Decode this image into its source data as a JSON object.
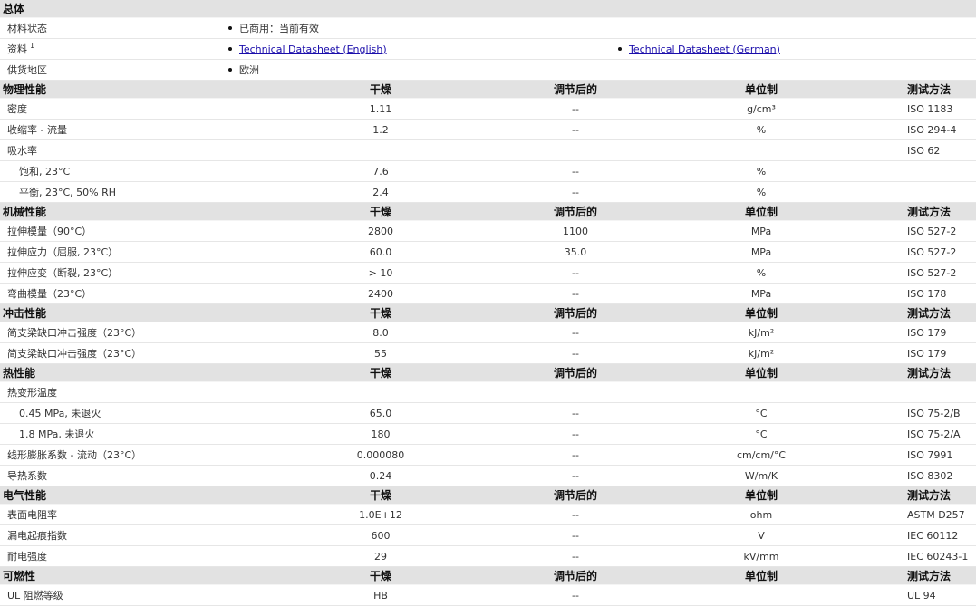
{
  "general": {
    "title": "总体",
    "status_label": "材料状态",
    "status_value": "已商用：当前有效",
    "docs_label": "资料",
    "docs_sup": "1",
    "doc_en": "Technical Datasheet (English)",
    "doc_de": "Technical Datasheet (German)",
    "region_label": "供货地区",
    "region_value": "欧洲"
  },
  "columns": {
    "dry": "干燥",
    "cond": "调节后的",
    "unit": "单位制",
    "method": "测试方法"
  },
  "sections": [
    {
      "title": "物理性能",
      "rows": [
        {
          "name": "密度",
          "dry": "1.11",
          "cond": "--",
          "unit": "g/cm³",
          "method": "ISO 1183"
        },
        {
          "name": "收缩率  - 流量",
          "dry": "1.2",
          "cond": "--",
          "unit": "%",
          "method": "ISO 294-4"
        },
        {
          "name": "吸水率",
          "dry": "",
          "cond": "",
          "unit": "",
          "method": "ISO 62"
        },
        {
          "name": "饱和, 23°C",
          "sub": true,
          "dry": "7.6",
          "cond": "--",
          "unit": "%",
          "method": ""
        },
        {
          "name": "平衡, 23°C, 50% RH",
          "sub": true,
          "dry": "2.4",
          "cond": "--",
          "unit": "%",
          "method": ""
        }
      ]
    },
    {
      "title": "机械性能",
      "rows": [
        {
          "name": "拉伸模量（90°C）",
          "dry": "2800",
          "cond": "1100",
          "unit": "MPa",
          "method": "ISO 527-2"
        },
        {
          "name": "拉伸应力（屈服, 23°C）",
          "dry": "60.0",
          "cond": "35.0",
          "unit": "MPa",
          "method": "ISO 527-2"
        },
        {
          "name": "拉伸应变（断裂, 23°C）",
          "dry": "> 10",
          "cond": "--",
          "unit": "%",
          "method": "ISO 527-2"
        },
        {
          "name": "弯曲模量（23°C）",
          "dry": "2400",
          "cond": "--",
          "unit": "MPa",
          "method": "ISO 178"
        }
      ]
    },
    {
      "title": "冲击性能",
      "rows": [
        {
          "name": "简支梁缺口冲击强度（23°C）",
          "dry": "8.0",
          "cond": "--",
          "unit": "kJ/m²",
          "method": "ISO 179"
        },
        {
          "name": "简支梁缺口冲击强度（23°C）",
          "dry": "55",
          "cond": "--",
          "unit": "kJ/m²",
          "method": "ISO 179"
        }
      ]
    },
    {
      "title": "热性能",
      "rows": [
        {
          "name": "热变形温度",
          "dry": "",
          "cond": "",
          "unit": "",
          "method": ""
        },
        {
          "name": "0.45 MPa, 未退火",
          "sub": true,
          "dry": "65.0",
          "cond": "--",
          "unit": "°C",
          "method": "ISO 75-2/B"
        },
        {
          "name": "1.8 MPa, 未退火",
          "sub": true,
          "dry": "180",
          "cond": "--",
          "unit": "°C",
          "method": "ISO 75-2/A"
        },
        {
          "name": "线形膨胀系数  - 流动（23°C）",
          "dry": "0.000080",
          "cond": "--",
          "unit": "cm/cm/°C",
          "method": "ISO 7991"
        },
        {
          "name": "导热系数",
          "dry": "0.24",
          "cond": "--",
          "unit": "W/m/K",
          "method": "ISO 8302"
        }
      ]
    },
    {
      "title": "电气性能",
      "rows": [
        {
          "name": "表面电阻率",
          "dry": "1.0E+12",
          "cond": "--",
          "unit": "ohm",
          "method": "ASTM D257"
        },
        {
          "name": "漏电起痕指数",
          "dry": "600",
          "cond": "--",
          "unit": "V",
          "method": "IEC 60112"
        },
        {
          "name": "耐电强度",
          "dry": "29",
          "cond": "--",
          "unit": "kV/mm",
          "method": "IEC 60243-1"
        }
      ]
    },
    {
      "title": "可燃性",
      "rows": [
        {
          "name": "UL 阻燃等级",
          "dry": "HB",
          "cond": "--",
          "unit": "",
          "method": "UL 94"
        }
      ]
    }
  ]
}
